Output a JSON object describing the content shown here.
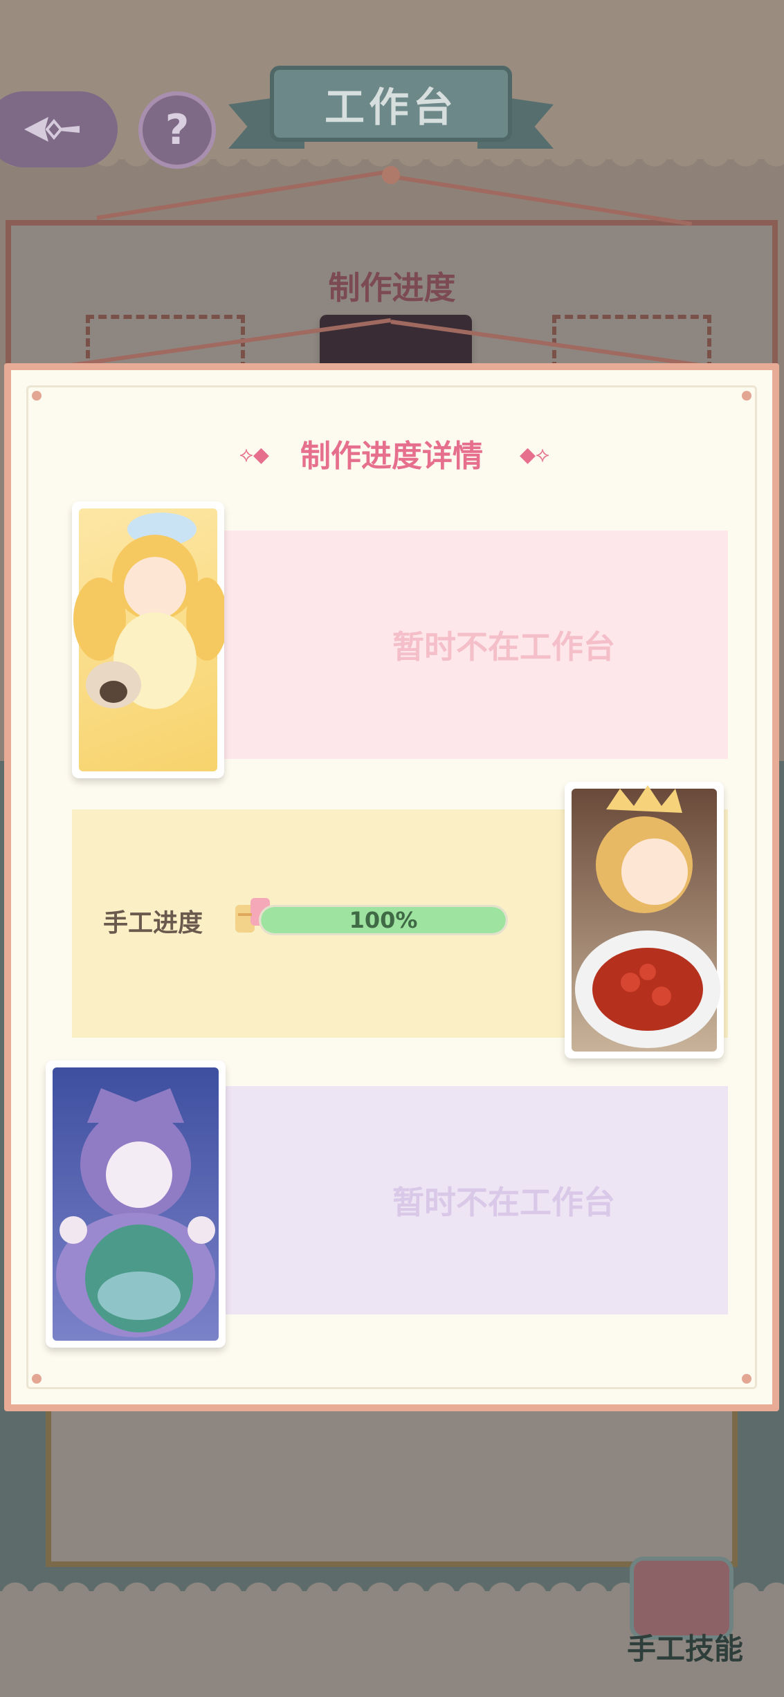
{
  "header": {
    "back_icon": "compass-arrow-icon",
    "help_symbol": "?",
    "title": "工作台"
  },
  "background_panel": {
    "title": "制作进度"
  },
  "modal": {
    "title": "制作进度详情",
    "cards": [
      {
        "status": "暂时不在工作台",
        "character": "blonde-girl-with-pug"
      },
      {
        "progress_label": "手工进度",
        "progress_text": "100%",
        "progress_value": 1.0,
        "character": "princess-with-roses"
      },
      {
        "status": "暂时不在工作台",
        "character": "hooded-girl-with-globe"
      }
    ]
  },
  "footer": {
    "skill_button_label": "手工技能"
  },
  "colors": {
    "title_pink": "#e56f8c",
    "pink_card": "#fde7ea",
    "yellow_card": "#fbefc6",
    "purple_card": "#eee5f4",
    "progress_green": "#9fe3a0"
  }
}
